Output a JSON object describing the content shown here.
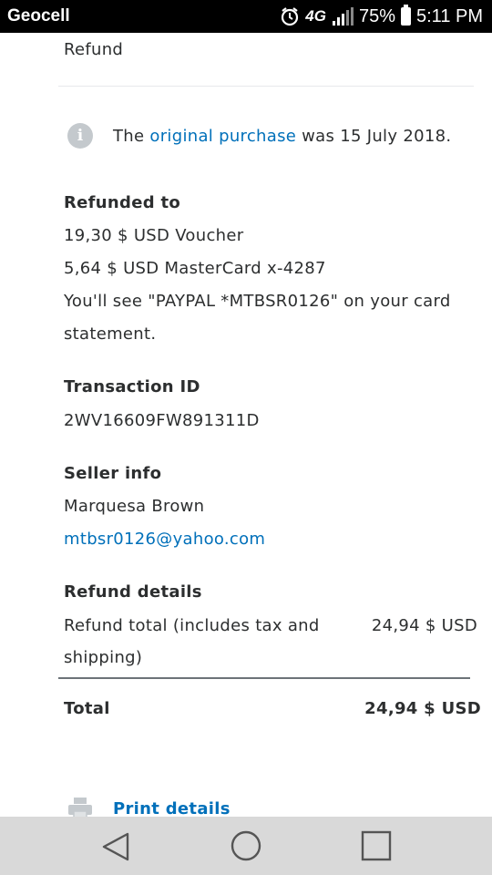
{
  "status_bar": {
    "carrier": "Geocell",
    "network": "4G",
    "battery": "75%",
    "time": "5:11 PM"
  },
  "header": {
    "title": "Refund"
  },
  "info": {
    "prefix": "The ",
    "link": "original purchase",
    "suffix": " was 15 July 2018."
  },
  "refunded_to": {
    "heading": "Refunded to",
    "line1": "19,30 $ USD Voucher",
    "line2": "5,64 $ USD MasterCard x-4287",
    "note_line1": "You'll see \"PAYPAL *MTBSR0126\" on your card",
    "note_line2": "statement."
  },
  "transaction": {
    "heading": "Transaction ID",
    "id": "2WV16609FW891311D"
  },
  "seller": {
    "heading": "Seller info",
    "name": "Marquesa Brown",
    "email": "mtbsr0126@yahoo.com"
  },
  "refund_details": {
    "heading": "Refund details",
    "row_label_line1": "Refund total (includes tax and",
    "row_label_line2": "shipping)",
    "row_value": "24,94 $ USD"
  },
  "total": {
    "label": "Total",
    "value": "24,94 $ USD"
  },
  "actions": {
    "print_label": "Print details",
    "print_icon": "printer-icon"
  },
  "nav": {
    "back_icon": "back-triangle-icon",
    "home_icon": "home-circle-icon",
    "recents_icon": "recents-square-icon"
  },
  "colors": {
    "link": "#0070ba",
    "text": "#2c2e2f",
    "status_bar": "#000000",
    "nav_bar": "#d9d9d9"
  }
}
